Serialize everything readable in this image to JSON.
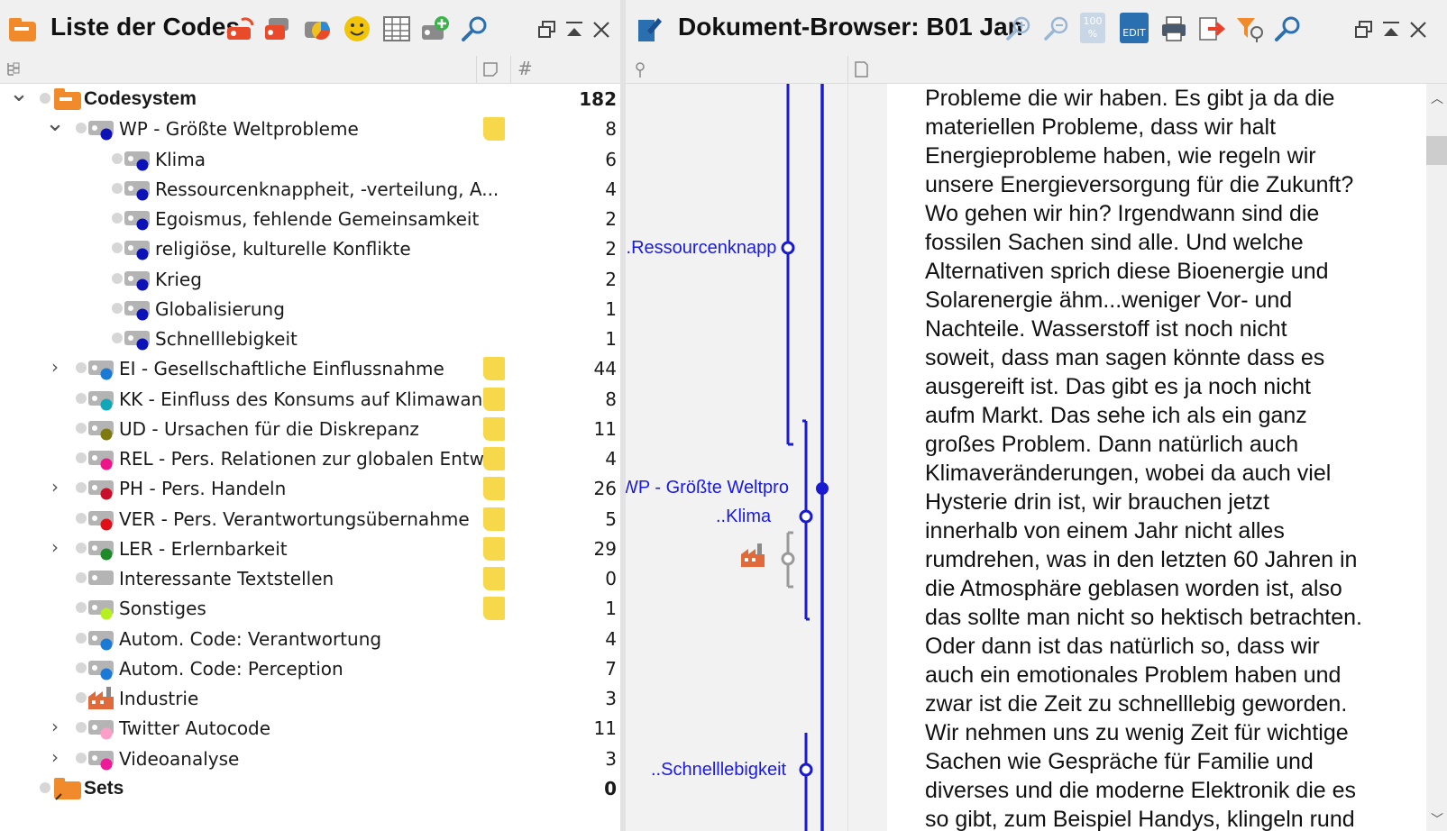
{
  "left": {
    "title": "Liste der Codes",
    "subbar": {
      "col_hash": "#"
    },
    "rows": [
      {
        "label": "Codesystem",
        "count": "182",
        "color": "",
        "level": 0,
        "expand": "open",
        "bold": true,
        "memo": false
      },
      {
        "label": "WP - Größte Weltprobleme",
        "count": "8",
        "color": "#0c12b8",
        "level": 1,
        "expand": "open",
        "bold": false,
        "memo": true
      },
      {
        "label": "Klima",
        "count": "6",
        "color": "#0c12b8",
        "level": 2,
        "expand": "",
        "bold": false,
        "memo": false
      },
      {
        "label": "Ressourcenknappheit, -verteilung, A...",
        "count": "4",
        "color": "#0c12b8",
        "level": 2,
        "expand": "",
        "bold": false,
        "memo": false
      },
      {
        "label": "Egoismus, fehlende Gemeinsamkeit",
        "count": "2",
        "color": "#0c12b8",
        "level": 2,
        "expand": "",
        "bold": false,
        "memo": false
      },
      {
        "label": "religiöse, kulturelle Konflikte",
        "count": "2",
        "color": "#0c12b8",
        "level": 2,
        "expand": "",
        "bold": false,
        "memo": false
      },
      {
        "label": "Krieg",
        "count": "2",
        "color": "#0c12b8",
        "level": 2,
        "expand": "",
        "bold": false,
        "memo": false
      },
      {
        "label": "Globalisierung",
        "count": "1",
        "color": "#0c12b8",
        "level": 2,
        "expand": "",
        "bold": false,
        "memo": false
      },
      {
        "label": "Schnelllebigkeit",
        "count": "1",
        "color": "#0c12b8",
        "level": 2,
        "expand": "",
        "bold": false,
        "memo": false
      },
      {
        "label": "EI - Gesellschaftliche Einflussnahme",
        "count": "44",
        "color": "#1a7ad6",
        "level": 1,
        "expand": "closed",
        "bold": false,
        "memo": true
      },
      {
        "label": "KK - Einfluss des Konsums auf Klimawan...",
        "count": "8",
        "color": "#11a6b8",
        "level": 1,
        "expand": "",
        "bold": false,
        "memo": true
      },
      {
        "label": "UD - Ursachen für die Diskrepanz",
        "count": "11",
        "color": "#7f7a10",
        "level": 1,
        "expand": "",
        "bold": false,
        "memo": true
      },
      {
        "label": "REL - Pers. Relationen zur globalen Entw...",
        "count": "4",
        "color": "#f0148a",
        "level": 1,
        "expand": "",
        "bold": false,
        "memo": true
      },
      {
        "label": "PH - Pers. Handeln",
        "count": "26",
        "color": "#c8102a",
        "level": 1,
        "expand": "closed",
        "bold": false,
        "memo": true
      },
      {
        "label": "VER - Pers. Verantwortungsübernahme",
        "count": "5",
        "color": "#e0101a",
        "level": 1,
        "expand": "",
        "bold": false,
        "memo": true
      },
      {
        "label": "LER - Erlernbarkeit",
        "count": "29",
        "color": "#1e8a2a",
        "level": 1,
        "expand": "closed",
        "bold": false,
        "memo": true
      },
      {
        "label": "Interessante Textstellen",
        "count": "0",
        "color": "",
        "level": 1,
        "expand": "",
        "bold": false,
        "memo": true
      },
      {
        "label": "Sonstiges",
        "count": "1",
        "color": "#b6f020",
        "level": 1,
        "expand": "",
        "bold": false,
        "memo": true
      },
      {
        "label": "Autom. Code: Verantwortung",
        "count": "4",
        "color": "#1a7ad6",
        "level": 1,
        "expand": "",
        "bold": false,
        "memo": false
      },
      {
        "label": "Autom. Code: Perception",
        "count": "7",
        "color": "#1a7ad6",
        "level": 1,
        "expand": "",
        "bold": false,
        "memo": false
      },
      {
        "label": "Industrie",
        "count": "3",
        "color": "",
        "level": 1,
        "expand": "",
        "bold": false,
        "memo": false,
        "icon": "factory-icon"
      },
      {
        "label": "Twitter Autocode",
        "count": "11",
        "color": "#ff9ec8",
        "level": 1,
        "expand": "closed",
        "bold": false,
        "memo": false
      },
      {
        "label": "Videoanalyse",
        "count": "3",
        "color": "#ee1a9a",
        "level": 1,
        "expand": "closed",
        "bold": false,
        "memo": false
      },
      {
        "label": "Sets",
        "count": "0",
        "color": "",
        "level": 0,
        "expand": "",
        "bold": true,
        "memo": false,
        "icon": "sets-folder-icon"
      }
    ]
  },
  "right": {
    "title": "Dokument-Browser: B01 Jan",
    "zoom_label": "100 %",
    "edit_label": "EDIT",
    "margin_labels": {
      "ressourcen": "..Ressourcenknapp",
      "wp": "WP - Größte Weltpro",
      "klima": "..Klima",
      "schnell": "..Schnelllebigkeit"
    },
    "lines": [
      "Probleme die wir haben. Es gibt ja da die",
      "materiellen Probleme, dass wir halt",
      "Energieprobleme haben, wie regeln wir",
      "unsere Energieversorgung für die Zukunft?",
      "Wo gehen wir hin? Irgendwann sind die",
      "fossilen Sachen sind alle. Und welche",
      "Alternativen sprich diese Bioenergie und",
      "Solarenergie ähm...weniger Vor- und",
      "Nachteile. Wasserstoff ist noch nicht",
      "soweit, dass man sagen könnte dass es",
      "ausgereift ist. Das gibt es ja noch nicht",
      "aufm Markt. Das sehe ich als ein ganz",
      "großes Problem. Dann natürlich auch",
      "Klimaveränderungen, wobei da auch viel",
      "Hysterie drin ist, wir brauchen jetzt",
      "innerhalb von einem Jahr nicht alles",
      "rumdrehen, was in den letzten 60 Jahren in",
      "die Atmosphäre geblasen worden ist, also",
      "das sollte man nicht so hektisch betrachten.",
      "Oder dann ist das natürlich so, dass wir",
      "auch ein emotionales Problem haben und",
      "zwar ist die Zeit zu schnelllebig geworden.",
      "Wir nehmen uns zu wenig Zeit für wichtige",
      "Sachen wie Gespräche für Familie und",
      "diverses und die moderne Elektronik die es",
      "so gibt, zum Beispiel Handys, klingeln rund"
    ]
  },
  "colors": {
    "memo": "#f7d84a",
    "code_blue": "#0c12b8",
    "margin_line": "#1a1ad0",
    "accent_orange": "#f08a2a"
  }
}
